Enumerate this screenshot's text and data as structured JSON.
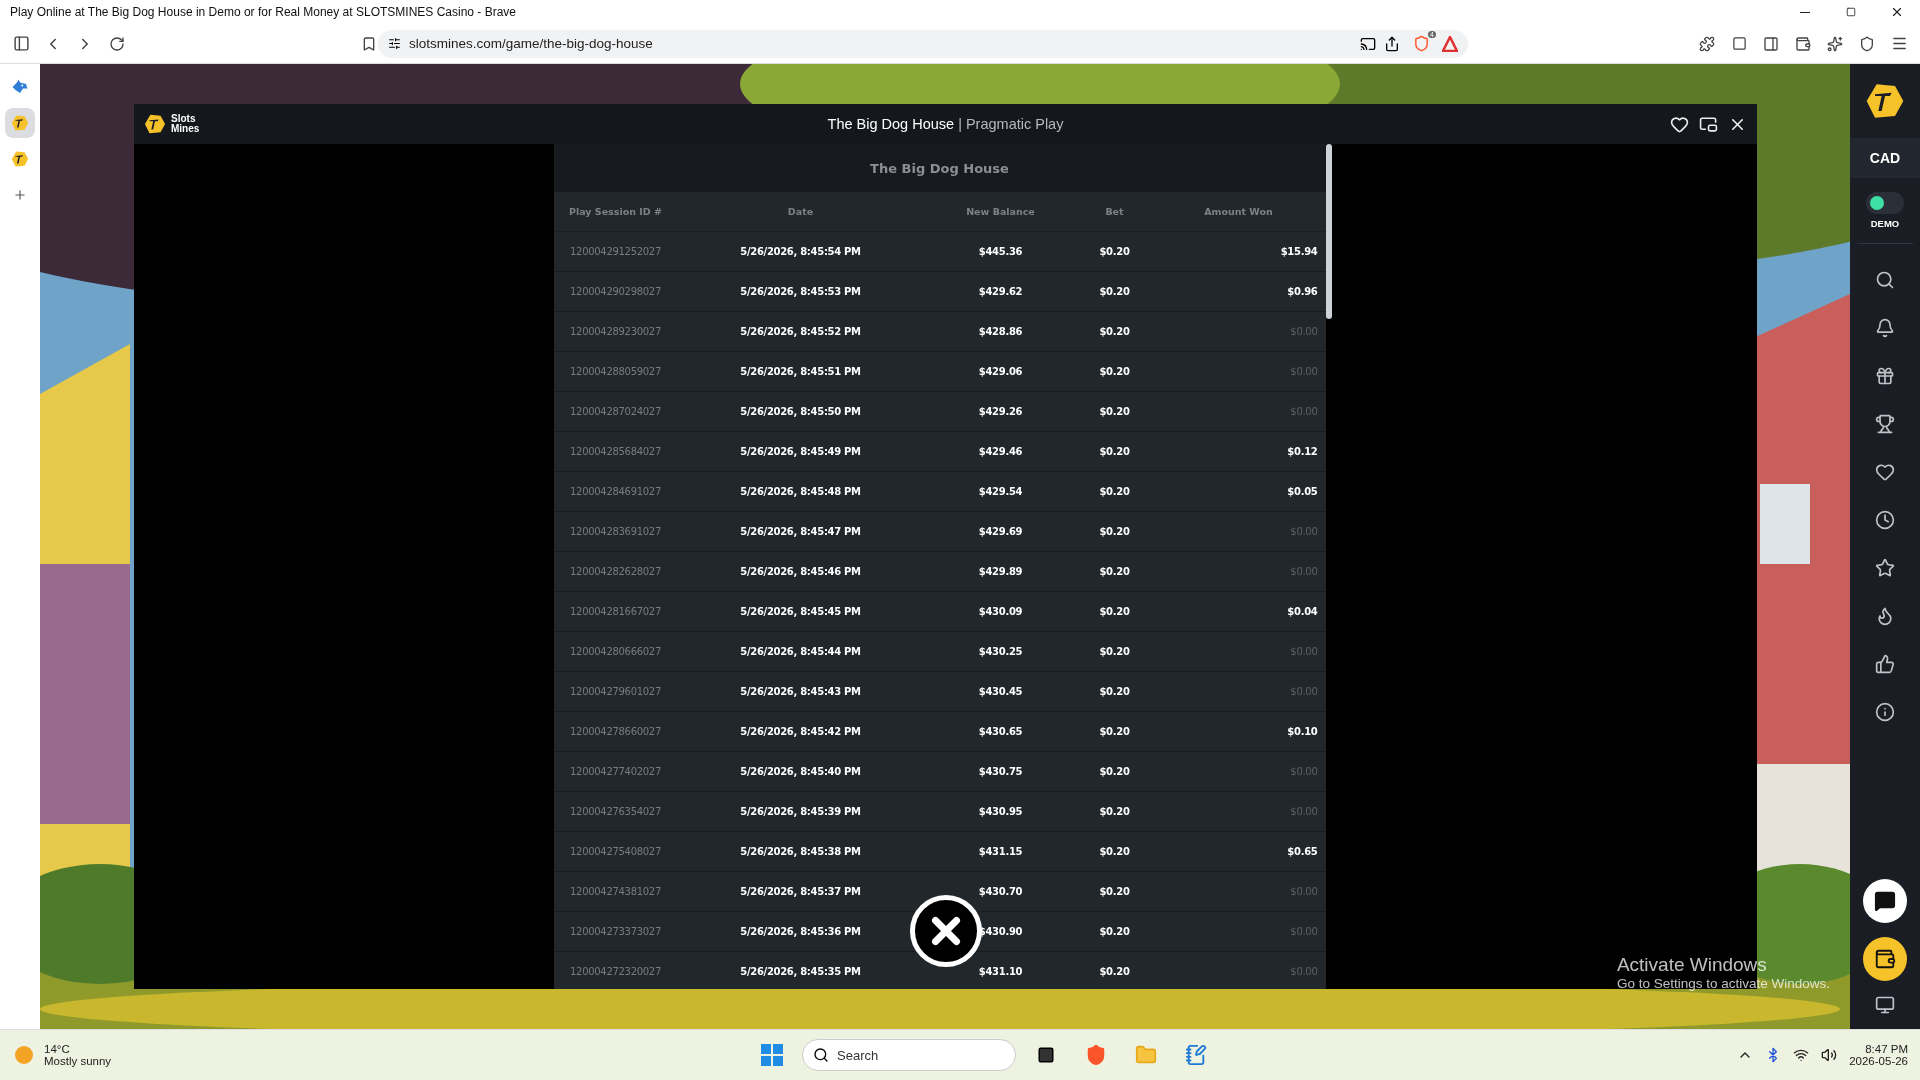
{
  "browser": {
    "title": "Play Online at The Big Dog House in Demo or for Real Money at SLOTSMINES Casino - Brave",
    "url": "slotsmines.com/game/the-big-dog-house",
    "shield_badge": "4",
    "side_panel": [
      {
        "kind": "wolf",
        "selected": false
      },
      {
        "kind": "mines",
        "selected": true
      },
      {
        "kind": "mines",
        "selected": false
      },
      {
        "kind": "add",
        "selected": false
      }
    ]
  },
  "game_window": {
    "logo": [
      "Slots",
      "Mines"
    ],
    "title": "The Big Dog House",
    "provider": "| Pragmatic Play"
  },
  "history": {
    "title": "The Big Dog House",
    "columns": [
      "Play Session ID #",
      "Date",
      "New Balance",
      "Bet",
      "Amount Won"
    ],
    "rows": [
      {
        "id": "120004291252027",
        "date": "5/26/2026, 8:45:54 PM",
        "balance": "$445.36",
        "bet": "$0.20",
        "won": "$15.94",
        "dim": false
      },
      {
        "id": "120004290298027",
        "date": "5/26/2026, 8:45:53 PM",
        "balance": "$429.62",
        "bet": "$0.20",
        "won": "$0.96",
        "dim": false
      },
      {
        "id": "120004289230027",
        "date": "5/26/2026, 8:45:52 PM",
        "balance": "$428.86",
        "bet": "$0.20",
        "won": "$0.00",
        "dim": true
      },
      {
        "id": "120004288059027",
        "date": "5/26/2026, 8:45:51 PM",
        "balance": "$429.06",
        "bet": "$0.20",
        "won": "$0.00",
        "dim": true
      },
      {
        "id": "120004287024027",
        "date": "5/26/2026, 8:45:50 PM",
        "balance": "$429.26",
        "bet": "$0.20",
        "won": "$0.00",
        "dim": true
      },
      {
        "id": "120004285684027",
        "date": "5/26/2026, 8:45:49 PM",
        "balance": "$429.46",
        "bet": "$0.20",
        "won": "$0.12",
        "dim": false
      },
      {
        "id": "120004284691027",
        "date": "5/26/2026, 8:45:48 PM",
        "balance": "$429.54",
        "bet": "$0.20",
        "won": "$0.05",
        "dim": false
      },
      {
        "id": "120004283691027",
        "date": "5/26/2026, 8:45:47 PM",
        "balance": "$429.69",
        "bet": "$0.20",
        "won": "$0.00",
        "dim": true
      },
      {
        "id": "120004282628027",
        "date": "5/26/2026, 8:45:46 PM",
        "balance": "$429.89",
        "bet": "$0.20",
        "won": "$0.00",
        "dim": true
      },
      {
        "id": "120004281667027",
        "date": "5/26/2026, 8:45:45 PM",
        "balance": "$430.09",
        "bet": "$0.20",
        "won": "$0.04",
        "dim": false
      },
      {
        "id": "120004280666027",
        "date": "5/26/2026, 8:45:44 PM",
        "balance": "$430.25",
        "bet": "$0.20",
        "won": "$0.00",
        "dim": true
      },
      {
        "id": "120004279601027",
        "date": "5/26/2026, 8:45:43 PM",
        "balance": "$430.45",
        "bet": "$0.20",
        "won": "$0.00",
        "dim": true
      },
      {
        "id": "120004278660027",
        "date": "5/26/2026, 8:45:42 PM",
        "balance": "$430.65",
        "bet": "$0.20",
        "won": "$0.10",
        "dim": false
      },
      {
        "id": "120004277402027",
        "date": "5/26/2026, 8:45:40 PM",
        "balance": "$430.75",
        "bet": "$0.20",
        "won": "$0.00",
        "dim": true
      },
      {
        "id": "120004276354027",
        "date": "5/26/2026, 8:45:39 PM",
        "balance": "$430.95",
        "bet": "$0.20",
        "won": "$0.00",
        "dim": true
      },
      {
        "id": "120004275408027",
        "date": "5/26/2026, 8:45:38 PM",
        "balance": "$431.15",
        "bet": "$0.20",
        "won": "$0.65",
        "dim": false
      },
      {
        "id": "120004274381027",
        "date": "5/26/2026, 8:45:37 PM",
        "balance": "$430.70",
        "bet": "$0.20",
        "won": "$0.00",
        "dim": true
      },
      {
        "id": "120004273373027",
        "date": "5/26/2026, 8:45:36 PM",
        "balance": "$430.90",
        "bet": "$0.20",
        "won": "$0.00",
        "dim": true
      },
      {
        "id": "120004272320027",
        "date": "5/26/2026, 8:45:35 PM",
        "balance": "$431.10",
        "bet": "$0.20",
        "won": "$0.00",
        "dim": true
      }
    ]
  },
  "sidebar": {
    "currency": "CAD",
    "demo_label": "DEMO",
    "demo_on": true,
    "icons": [
      {
        "kind": "search"
      },
      {
        "kind": "bell"
      },
      {
        "kind": "gift"
      },
      {
        "kind": "trophy"
      },
      {
        "kind": "heart"
      },
      {
        "kind": "clock"
      },
      {
        "kind": "star"
      },
      {
        "kind": "flame"
      },
      {
        "kind": "thumbs-up"
      },
      {
        "kind": "info"
      }
    ]
  },
  "activation": {
    "title": "Activate Windows",
    "hint": "Go to Settings to activate Windows."
  },
  "taskbar": {
    "temperature": "14°C",
    "weather": "Mostly sunny",
    "search_placeholder": "Search",
    "time": "8:47 PM",
    "date": "2026-05-26"
  }
}
